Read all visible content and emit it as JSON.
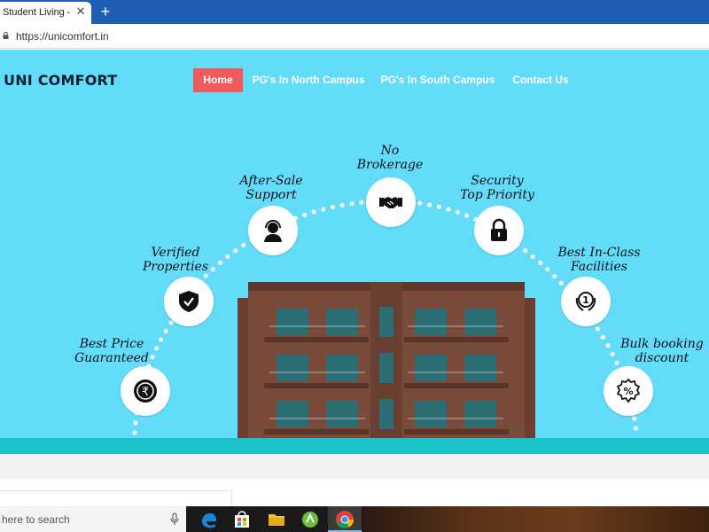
{
  "browser": {
    "tab_title": "Student Living – S",
    "tab_close": "✕",
    "new_tab": "+",
    "url": "https://unicomfort.in"
  },
  "site": {
    "logo": "UNI COMFORT",
    "nav": {
      "home": "Home",
      "north": "PG's In North Campus",
      "south": "PG's In South Campus",
      "contact": "Contact Us"
    },
    "features": {
      "best_price": "Best Price\nGuaranteed",
      "verified": "Verified\nProperties",
      "after_sale": "After-Sale\nSupport",
      "brokerage": "No\nBrokerage",
      "security": "Security\nTop Priority",
      "facilities": "Best In-Class\nFacilities",
      "bulk": "Bulk booking\ndiscount"
    },
    "colors": {
      "hero_bg": "#62dcf9",
      "nav_active": "#ef5a5a",
      "ground": "#19c3c8"
    }
  },
  "taskbar": {
    "search_placeholder": "here to search",
    "icons": [
      "edge-icon",
      "store-icon",
      "file-explorer-icon",
      "app-icon",
      "chrome-icon"
    ]
  }
}
